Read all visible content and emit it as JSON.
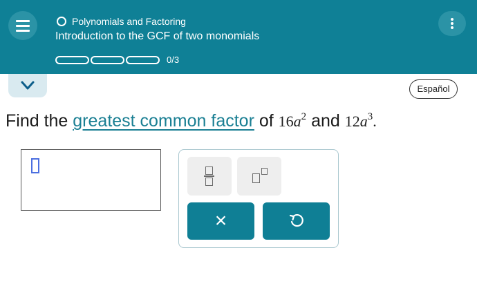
{
  "header": {
    "topic": "Polynomials and Factoring",
    "lesson": "Introduction to the GCF of two monomials",
    "progress": {
      "text": "0/3",
      "completed": 0,
      "total": 3
    },
    "menu_icon": "hamburger-icon",
    "more_icon": "kebab-icon"
  },
  "language_button": "Español",
  "question": {
    "prefix": "Find the ",
    "link_text": "greatest common factor",
    "middle": " of ",
    "expr1": {
      "coef": "16",
      "var": "a",
      "exp": "2"
    },
    "conjunction": " and ",
    "expr2": {
      "coef": "12",
      "var": "a",
      "exp": "3"
    },
    "end": "."
  },
  "answer": {
    "value": ""
  },
  "keypad": {
    "clear_label": "×",
    "keys": [
      "fraction-icon",
      "exponent-icon",
      "clear-icon",
      "undo-icon"
    ]
  },
  "colors": {
    "header_bg": "#0f8096",
    "accent": "#0f7f95",
    "link": "#1a7f93",
    "caret": "#4c6fe0"
  }
}
